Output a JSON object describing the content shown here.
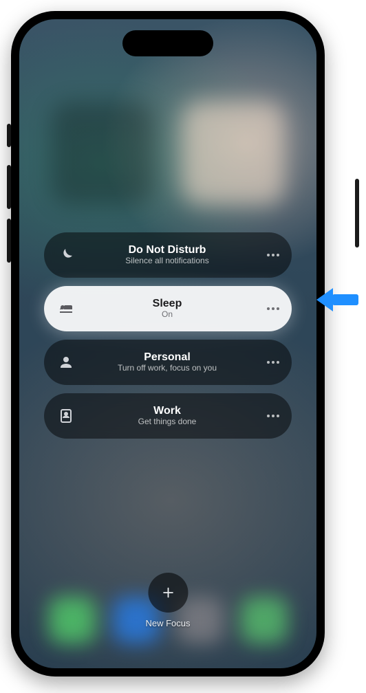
{
  "focus_modes": [
    {
      "id": "dnd",
      "icon": "moon-icon",
      "title": "Do Not Disturb",
      "subtitle": "Silence all notifications",
      "active": false
    },
    {
      "id": "sleep",
      "icon": "bed-icon",
      "title": "Sleep",
      "subtitle": "On",
      "active": true
    },
    {
      "id": "personal",
      "icon": "person-icon",
      "title": "Personal",
      "subtitle": "Turn off work, focus on you",
      "active": false
    },
    {
      "id": "work",
      "icon": "badge-icon",
      "title": "Work",
      "subtitle": "Get things done",
      "active": false
    }
  ],
  "new_focus": {
    "label": "New Focus"
  }
}
